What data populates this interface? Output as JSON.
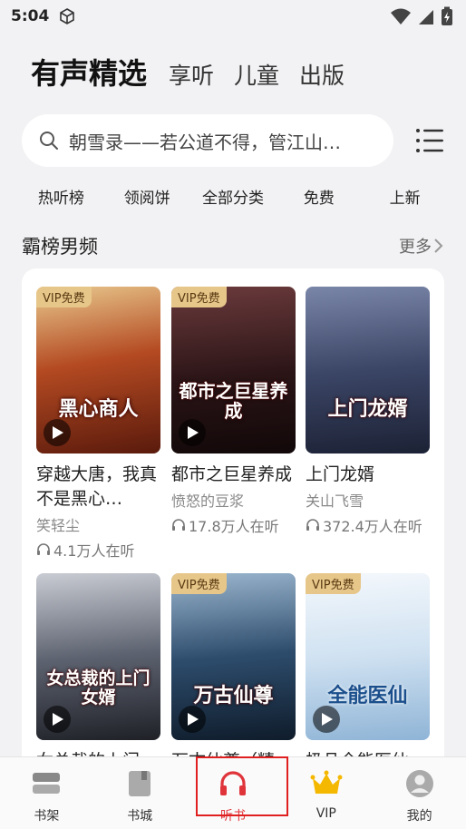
{
  "status_bar": {
    "time": "5:04"
  },
  "category_tabs": [
    {
      "label": "有声精选",
      "active": true
    },
    {
      "label": "享听",
      "active": false
    },
    {
      "label": "儿童",
      "active": false
    },
    {
      "label": "出版",
      "active": false
    }
  ],
  "search": {
    "text": "朝雪录——若公道不得，管江山…"
  },
  "quick_links": [
    "热听榜",
    "领阅饼",
    "全部分类",
    "免费",
    "上新"
  ],
  "section": {
    "title": "霸榜男频",
    "more": "更多"
  },
  "books": [
    {
      "badge": "VIP免费",
      "cover_text": "黑心商人",
      "title": "穿越大唐，我真不是黑心…",
      "author": "笑轻尘",
      "listens": "4.1万人在听",
      "color": "#9b3a1c"
    },
    {
      "badge": "VIP免费",
      "cover_text": "都市之巨星养成",
      "title": "都市之巨星养成",
      "author": "愤怒的豆浆",
      "listens": "17.8万人在听",
      "color": "#3a1f22"
    },
    {
      "badge": "",
      "cover_text": "上门龙婿",
      "title": "上门龙婿",
      "author": "关山飞雪",
      "listens": "372.4万人在听",
      "color": "#2e3550"
    },
    {
      "badge": "",
      "cover_text": "女总裁的上门女婿",
      "title": "女总裁的上门女…",
      "author": "",
      "listens": "",
      "color": "#3b3f48"
    },
    {
      "badge": "VIP免费",
      "cover_text": "万古仙尊",
      "title": "万古仙尊（精…",
      "author": "",
      "listens": "",
      "color": "#1f3a56"
    },
    {
      "badge": "VIP免费",
      "cover_text": "全能医仙",
      "title": "极品全能医仙",
      "author": "",
      "listens": "",
      "color": "#bcd6ec"
    }
  ],
  "bottom_nav": [
    {
      "label": "书架",
      "icon": "bookshelf-icon",
      "active": false
    },
    {
      "label": "书城",
      "icon": "bookstore-icon",
      "active": false
    },
    {
      "label": "听书",
      "icon": "headphones-icon",
      "active": true
    },
    {
      "label": "VIP",
      "icon": "crown-icon",
      "active": false
    },
    {
      "label": "我的",
      "icon": "profile-icon",
      "active": false
    }
  ],
  "colors": {
    "accent": "#e0343b",
    "vip_gold": "#e7c68a",
    "background": "#f2f2f4"
  }
}
